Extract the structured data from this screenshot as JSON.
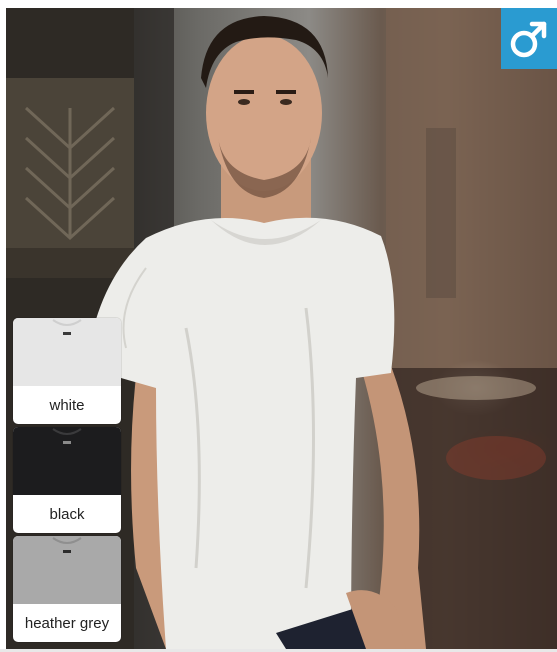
{
  "badge": {
    "icon": "male-symbol-icon",
    "color": "#2a9bd1"
  },
  "swatches": [
    {
      "label": "white",
      "color": "#e6e6e6"
    },
    {
      "label": "black",
      "color": "#1c1c1e"
    },
    {
      "label": "heather grey",
      "color": "#a9a9a9"
    }
  ]
}
